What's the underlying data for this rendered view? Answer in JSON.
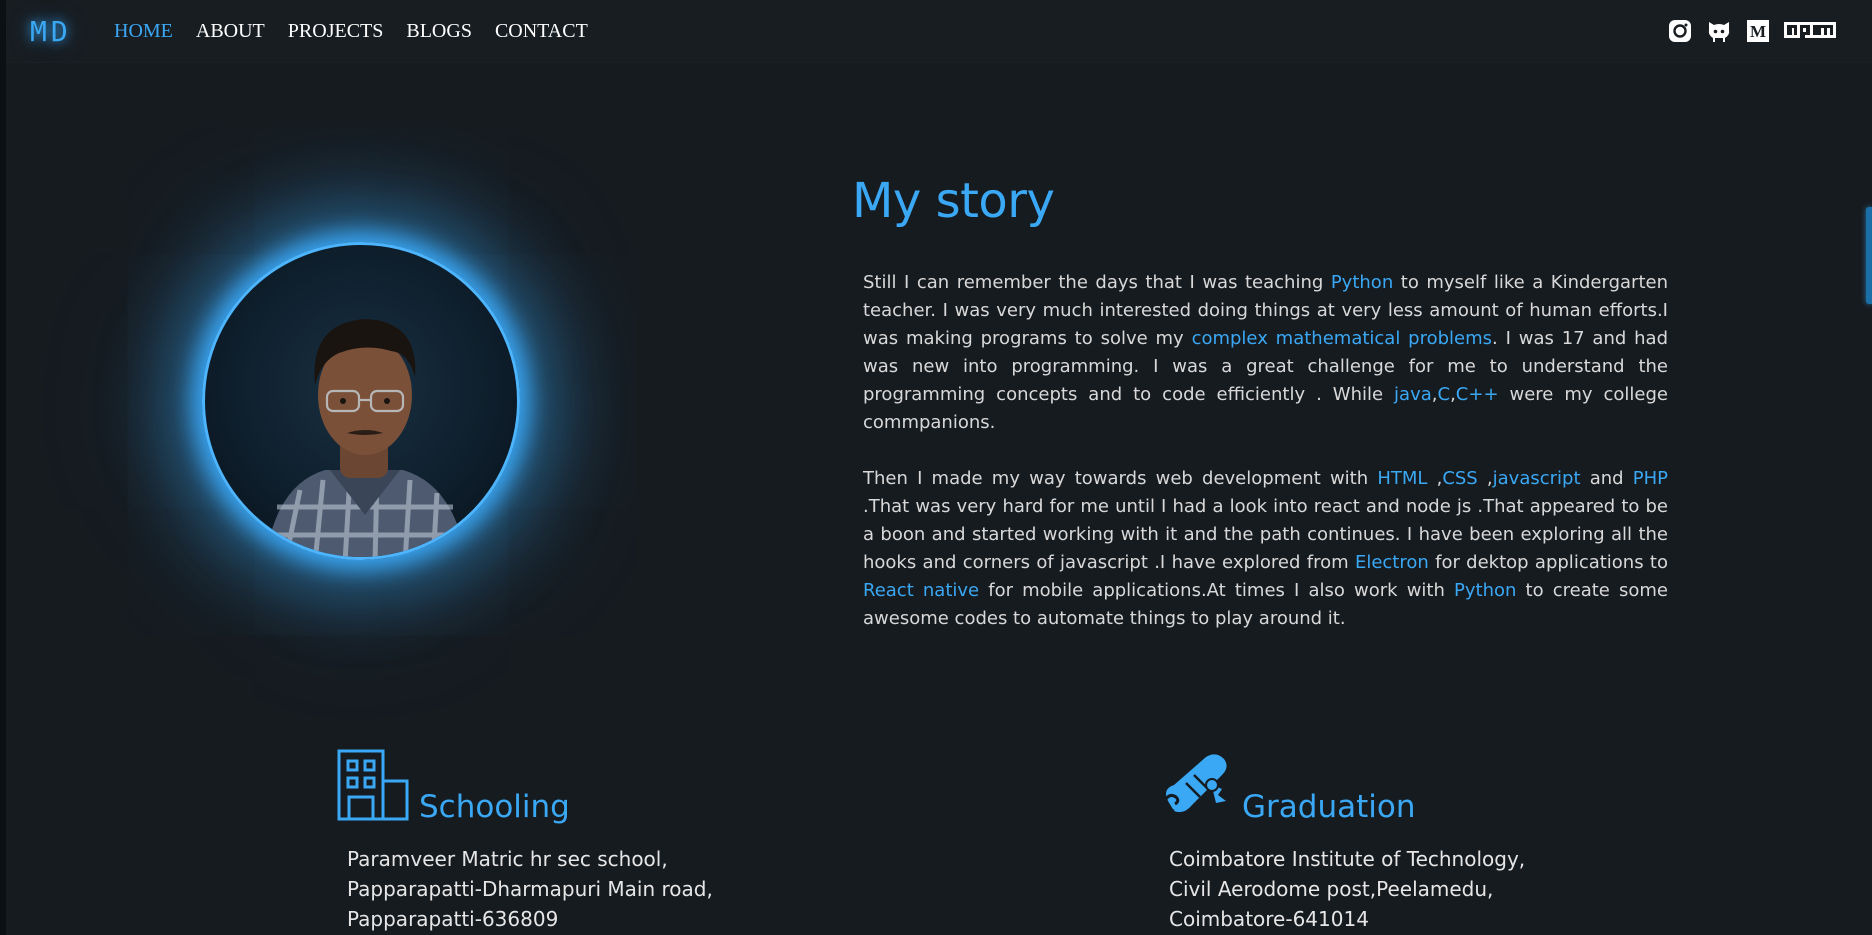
{
  "nav": {
    "logo": "MD",
    "links": [
      "HOME",
      "ABOUT",
      "PROJECTS",
      "BLOGS",
      "CONTACT"
    ],
    "social_icons": [
      "instagram-icon",
      "github-icon",
      "medium-icon",
      "npm-icon"
    ]
  },
  "colors": {
    "accent": "#3aa8f5",
    "background": "#161b20",
    "navbar": "#181d22"
  },
  "story": {
    "title": "My story",
    "p1": [
      {
        "t": "Still I can remember the days that I was teaching "
      },
      {
        "t": "Python",
        "hl": true
      },
      {
        "t": " to myself like a Kindergarten teacher. I was very much interested doing things at very less amount of human efforts.I was making programs to solve my "
      },
      {
        "t": "complex mathematical problems",
        "hl": true
      },
      {
        "t": ". I was 17 and had was new into programming. I was a great challenge for me to understand the programming concepts and to code efficiently . While "
      },
      {
        "t": "java",
        "hl": true
      },
      {
        "t": ","
      },
      {
        "t": "C",
        "hl": true
      },
      {
        "t": ","
      },
      {
        "t": "C++",
        "hl": true
      },
      {
        "t": " were my college commpanions."
      }
    ],
    "p2": [
      {
        "t": "Then I made my way towards web development with "
      },
      {
        "t": "HTML",
        "hl": true
      },
      {
        "t": " ,"
      },
      {
        "t": "CSS",
        "hl": true
      },
      {
        "t": " ,"
      },
      {
        "t": "javascript",
        "hl": true
      },
      {
        "t": " and "
      },
      {
        "t": "PHP",
        "hl": true
      },
      {
        "t": " .That was very hard for me until I had a look into react and node js .That appeared to be a boon and started working with it and the path continues. I have been exploring all the hooks and corners of javascript .I have explored from "
      },
      {
        "t": "Electron",
        "hl": true
      },
      {
        "t": " for dektop applications to "
      },
      {
        "t": "React native",
        "hl": true
      },
      {
        "t": " for mobile applications.At times I also work with "
      },
      {
        "t": "Python",
        "hl": true
      },
      {
        "t": " to create some awesome codes to automate things to play around it."
      }
    ]
  },
  "education": {
    "schooling": {
      "title": "Schooling",
      "icon": "building-icon",
      "lines": [
        "Paramveer Matric hr sec school,",
        "Papparapatti-Dharmapuri Main road,",
        "Papparapatti-636809"
      ]
    },
    "graduation": {
      "title": "Graduation",
      "icon": "diploma-scroll-icon",
      "lines": [
        "Coimbatore Institute of Technology,",
        "Civil Aerodome post,Peelamedu,",
        "Coimbatore-641014"
      ]
    }
  }
}
